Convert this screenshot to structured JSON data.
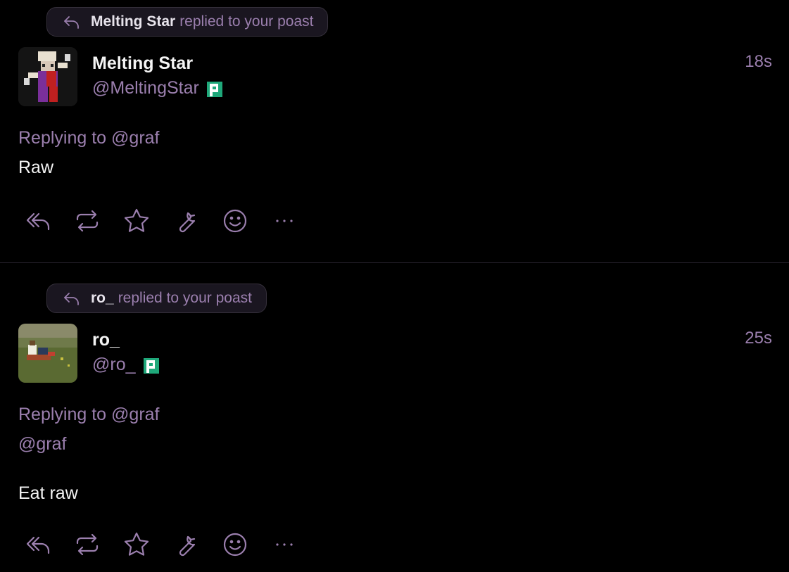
{
  "colors": {
    "accent": "#9b7fae",
    "background": "#000000",
    "pill_bg": "#1a1620",
    "text": "#f4f4f4"
  },
  "notifications": [
    {
      "pill_user": "Melting Star",
      "pill_action": "replied to your poast",
      "display_name": "Melting Star",
      "handle": "@MeltingStar",
      "time": "18s",
      "replying_prefix": "Replying to",
      "replying_to": "@graf",
      "content": "Raw",
      "avatar_icon": "jester-avatar"
    },
    {
      "pill_user": "ro_",
      "pill_action": "replied to your poast",
      "display_name": "ro_",
      "handle": "@ro_",
      "time": "25s",
      "replying_prefix": "Replying to",
      "replying_to": "@graf",
      "mention": "@graf",
      "content": "Eat raw",
      "avatar_icon": "painting-avatar"
    }
  ],
  "actions": [
    "reply-all-icon",
    "repost-icon",
    "star-icon",
    "wrench-icon",
    "emoji-icon",
    "more-icon"
  ]
}
